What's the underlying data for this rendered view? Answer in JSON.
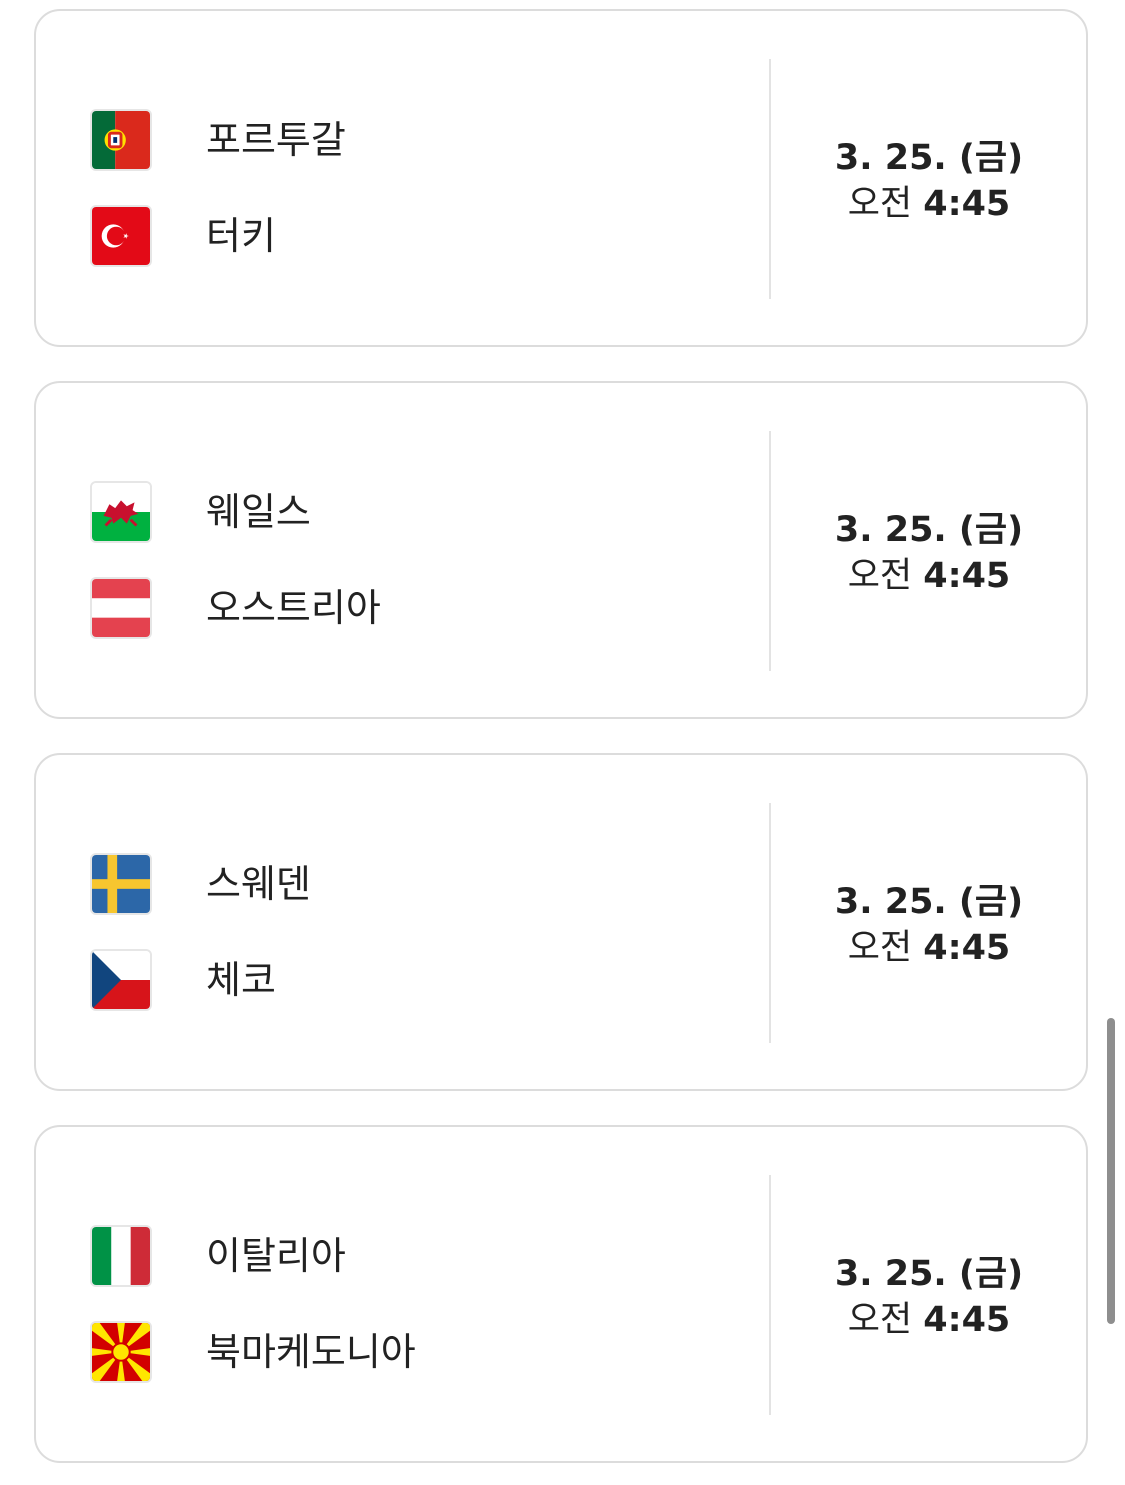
{
  "matches": [
    {
      "home": {
        "name": "포르투갈",
        "flag": "portugal-flag"
      },
      "away": {
        "name": "터키",
        "flag": "turkey-flag"
      },
      "date": "3. 25. (금)",
      "ampm": "오전",
      "time": "4:45"
    },
    {
      "home": {
        "name": "웨일스",
        "flag": "wales-flag"
      },
      "away": {
        "name": "오스트리아",
        "flag": "austria-flag"
      },
      "date": "3. 25. (금)",
      "ampm": "오전",
      "time": "4:45"
    },
    {
      "home": {
        "name": "스웨덴",
        "flag": "sweden-flag"
      },
      "away": {
        "name": "체코",
        "flag": "czech-flag"
      },
      "date": "3. 25. (금)",
      "ampm": "오전",
      "time": "4:45"
    },
    {
      "home": {
        "name": "이탈리아",
        "flag": "italy-flag"
      },
      "away": {
        "name": "북마케도니아",
        "flag": "north-macedonia-flag"
      },
      "date": "3. 25. (금)",
      "ampm": "오전",
      "time": "4:45"
    }
  ],
  "colors": {
    "card_border": "#dcdcdc",
    "text": "#222222",
    "divider": "#e3e3e3",
    "scrollbar": "#8e8e8e"
  }
}
